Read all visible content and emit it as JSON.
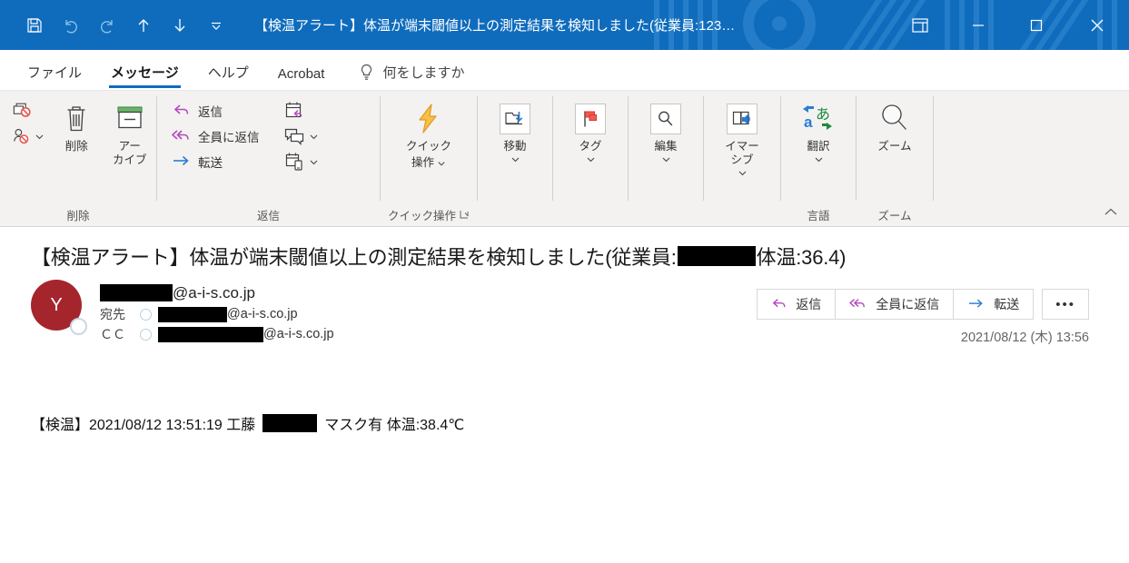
{
  "window": {
    "title": "【検温アラート】体温が端末閾値以上の測定結果を検知しました(従業員:123…",
    "accent_color": "#0f6cbd",
    "quick_access": [
      {
        "name": "save-button",
        "icon": "save-icon"
      },
      {
        "name": "undo-button",
        "icon": "undo-icon"
      },
      {
        "name": "redo-button",
        "icon": "redo-icon"
      },
      {
        "name": "previous-item-button",
        "icon": "arrow-up-icon"
      },
      {
        "name": "next-item-button",
        "icon": "arrow-down-icon"
      },
      {
        "name": "customize-quick-access-toolbar-button",
        "icon": "chevron-down-icon"
      }
    ],
    "controls": {
      "ribbon_display": "ribbon-display-options-icon",
      "minimize": "minimize-icon",
      "maximize": "maximize-icon",
      "close": "close-icon"
    }
  },
  "tabs": [
    {
      "label": "ファイル",
      "active": false
    },
    {
      "label": "メッセージ",
      "active": true
    },
    {
      "label": "ヘルプ",
      "active": false
    },
    {
      "label": "Acrobat",
      "active": false
    }
  ],
  "tell_me": {
    "icon": "lightbulb-icon",
    "label": "何をしますか"
  },
  "ribbon": {
    "groups": [
      {
        "label": "削除",
        "name": "ribbon-group-delete",
        "small_icons": [
          {
            "name": "ignore-button",
            "icon": "ignore-icon"
          },
          {
            "name": "block-sender-button",
            "icon": "block-sender-icon",
            "caret": true
          }
        ],
        "buttons": [
          {
            "label": "削除",
            "name": "delete-button",
            "icon": "trash-icon"
          },
          {
            "label": "アー\nカイブ",
            "name": "archive-button",
            "icon": "archive-icon"
          }
        ]
      },
      {
        "label": "返信",
        "name": "ribbon-group-reply",
        "items": [
          {
            "label": "返信",
            "name": "reply-button",
            "icon": "reply-icon"
          },
          {
            "label": "全員に返信",
            "name": "reply-all-button",
            "icon": "reply-all-icon"
          },
          {
            "label": "転送",
            "name": "forward-button",
            "icon": "forward-icon"
          }
        ],
        "extra_icons": [
          {
            "name": "meeting-button",
            "icon": "calendar-reply-icon",
            "caret": false
          },
          {
            "name": "im-button",
            "icon": "chat-bubbles-icon",
            "caret": true
          },
          {
            "name": "more-reply-actions-button",
            "icon": "calendar-phone-icon",
            "caret": true
          }
        ]
      },
      {
        "label": "クイック操作",
        "name": "ribbon-group-quick-steps",
        "dialog_launcher": true,
        "buttons": [
          {
            "label": "クイック\n操作",
            "name": "quick-steps-button",
            "icon": "lightning-bolt-icon",
            "caret": true
          }
        ]
      },
      {
        "label": "",
        "name": "ribbon-group-move",
        "buttons": [
          {
            "label": "移動",
            "name": "move-button",
            "icon": "move-to-folder-icon",
            "caret": true,
            "boxed": true
          }
        ]
      },
      {
        "label": "",
        "name": "ribbon-group-tags",
        "buttons": [
          {
            "label": "タグ",
            "name": "tags-button",
            "icon": "red-flag-icon",
            "caret": true,
            "boxed": true
          }
        ]
      },
      {
        "label": "",
        "name": "ribbon-group-editing",
        "buttons": [
          {
            "label": "編集",
            "name": "editing-button",
            "icon": "magnifier-icon",
            "caret": true,
            "boxed": true
          }
        ]
      },
      {
        "label": "",
        "name": "ribbon-group-immersive",
        "buttons": [
          {
            "label": "イマー\nシブ",
            "name": "immersive-reader-button",
            "icon": "read-aloud-icon",
            "caret": true,
            "boxed": true
          }
        ]
      },
      {
        "label": "言語",
        "name": "ribbon-group-language",
        "buttons": [
          {
            "label": "翻訳",
            "name": "translate-button",
            "icon": "translate-icon",
            "caret": true
          }
        ]
      },
      {
        "label": "ズーム",
        "name": "ribbon-group-zoom",
        "buttons": [
          {
            "label": "ズーム",
            "name": "zoom-button",
            "icon": "zoom-magnifier-icon"
          }
        ]
      }
    ],
    "collapse_icon": "chevron-up-icon"
  },
  "message": {
    "subject_prefix": "【検温アラート】体温が端末閾値以上の測定結果を検知しました(従業員:",
    "subject_suffix": "体温:36.4)",
    "avatar_initial": "Y",
    "from": "@a-i-s.co.jp",
    "to_label": "宛先",
    "to": "@a-i-s.co.jp",
    "cc_label": "ＣＣ",
    "cc": "@a-i-s.co.jp",
    "date": "2021/08/12 (木) 13:56",
    "actions": [
      {
        "label": "返信",
        "name": "reply-action-button",
        "icon": "reply-icon"
      },
      {
        "label": "全員に返信",
        "name": "reply-all-action-button",
        "icon": "reply-all-icon"
      },
      {
        "label": "転送",
        "name": "forward-action-button",
        "icon": "forward-icon"
      }
    ],
    "more_actions_label": "•••",
    "body_part1": "【検温】2021/08/12 13:51:19 工藤",
    "body_part2": "マスク有 体温:38.4℃"
  }
}
